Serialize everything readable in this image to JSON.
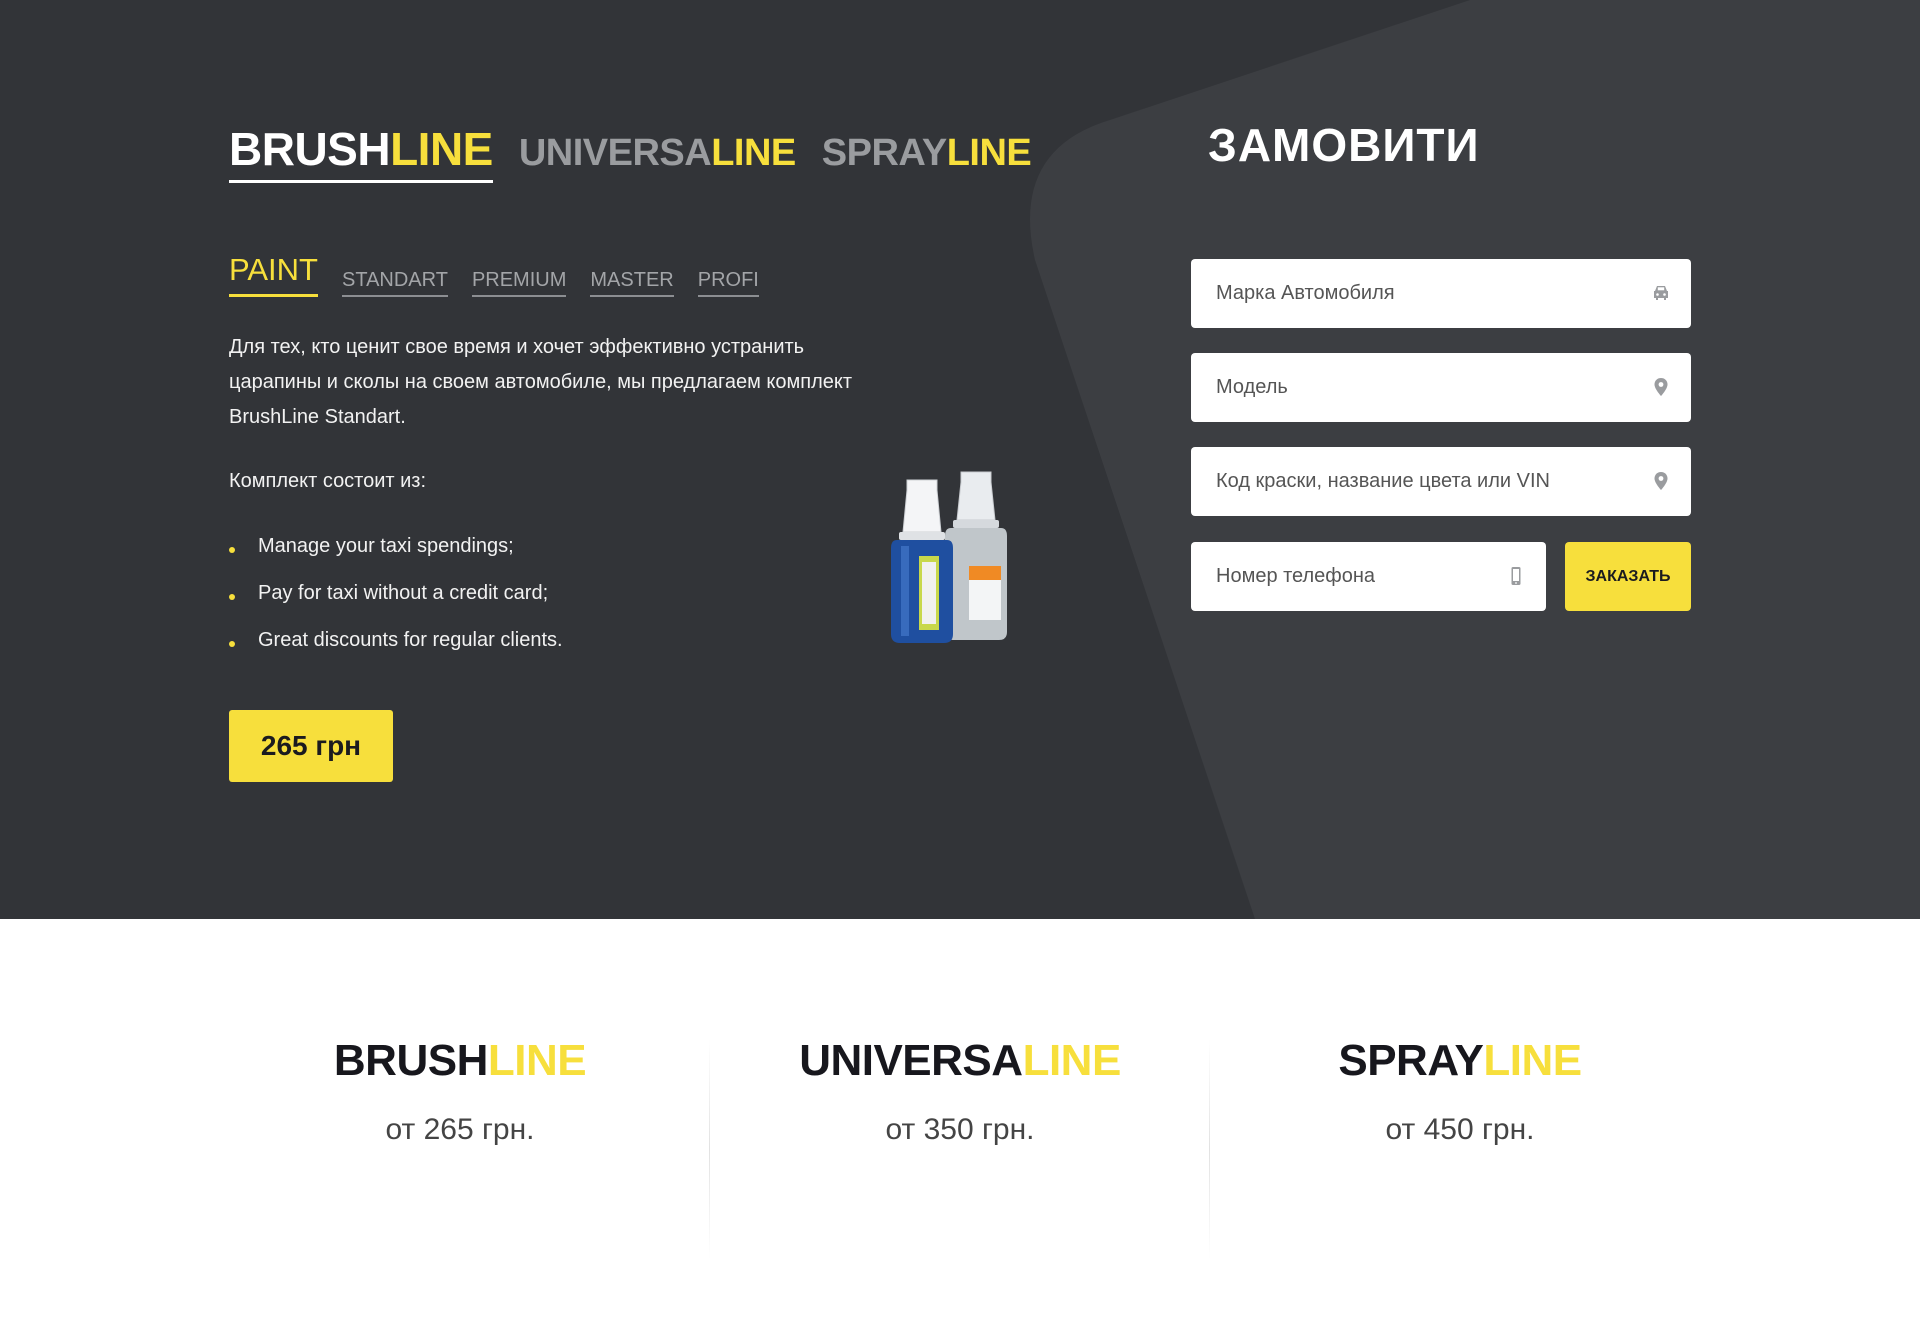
{
  "product_lines": [
    {
      "main": "BRUSH",
      "accent": "LINE",
      "active": true
    },
    {
      "main": "UNIVERSA",
      "accent": "LINE",
      "active": false
    },
    {
      "main": "SPRAY",
      "accent": "LINE",
      "active": false
    }
  ],
  "sub_tabs": [
    {
      "label": "PAINT",
      "active": true
    },
    {
      "label": "STANDART",
      "active": false
    },
    {
      "label": "PREMIUM",
      "active": false
    },
    {
      "label": "MASTER",
      "active": false
    },
    {
      "label": "PROFI",
      "active": false
    }
  ],
  "description": "Для тех, кто ценит свое время и хочет эффективно устранить царапины и сколы на своем автомобиле, мы предлагаем комплект BrushLine Standart.",
  "kit_title": "Комплект состоит из:",
  "bullets": [
    "Manage your taxi spendings;",
    "Pay for taxi without a credit card;",
    "Great discounts for regular clients."
  ],
  "price_button": "265 грн",
  "order": {
    "title": "ЗАМОВИТИ",
    "fields": [
      {
        "placeholder": "Марка Автомобиля",
        "icon": "car-icon"
      },
      {
        "placeholder": "Модель",
        "icon": "map-pin-icon"
      },
      {
        "placeholder": "Код краски, название цвета или VIN",
        "icon": "map-pin-icon"
      },
      {
        "placeholder": "Номер телефона",
        "icon": "phone-icon"
      }
    ],
    "submit_label": "ЗАКАЗАТЬ"
  },
  "bottom_lines": [
    {
      "main": "BRUSH",
      "accent": "LINE",
      "price": "от 265 грн."
    },
    {
      "main": "UNIVERSA",
      "accent": "LINE",
      "price": "от 350 грн."
    },
    {
      "main": "SPRAY",
      "accent": "LINE",
      "price": "от 450 грн."
    }
  ],
  "colors": {
    "background_dark": "#323438",
    "shape_dark": "#3c3e42",
    "accent_yellow": "#f7df3c",
    "text_light": "#ffffff"
  }
}
